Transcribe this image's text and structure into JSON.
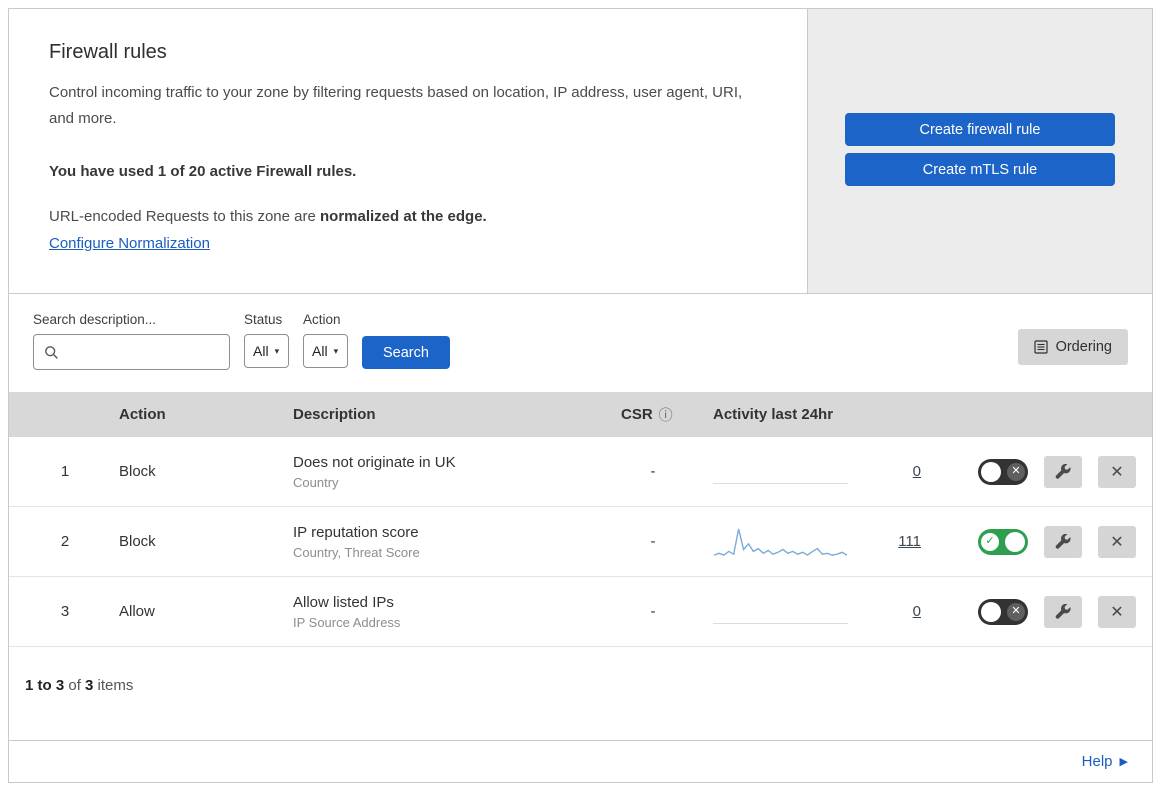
{
  "colors": {
    "primary_blue": "#1d64c8",
    "link_blue": "#1a5dc0",
    "toggle_on_green": "#2e9e4f",
    "toggle_off_dark": "#333333",
    "table_header_gray": "#d8d8d8",
    "side_panel_gray": "#ececec"
  },
  "icons": {
    "caret_down": "▾",
    "info": "ⓘ",
    "check": "✓",
    "cross": "✕",
    "delete_x": "✕",
    "help_arrow": "▶"
  },
  "header": {
    "title": "Firewall rules",
    "description": "Control incoming traffic to your zone by filtering requests based on location, IP address, user agent, URI, and more.",
    "usage": "You have used 1 of 20 active Firewall rules.",
    "normalization_prefix": "URL-encoded Requests to this zone are ",
    "normalization_bold": "normalized at the edge.",
    "configure_link": "Configure Normalization",
    "create_firewall_button": "Create firewall rule",
    "create_mtls_button": "Create mTLS rule"
  },
  "filters": {
    "search_label": "Search description...",
    "search_value": "",
    "status_label": "Status",
    "status_value": "All",
    "action_label": "Action",
    "action_value": "All",
    "search_button": "Search",
    "ordering_button": "Ordering"
  },
  "table": {
    "columns": {
      "action": "Action",
      "description": "Description",
      "csr": "CSR",
      "activity": "Activity last 24hr"
    },
    "rows": [
      {
        "index": "1",
        "action": "Block",
        "description": "Does not originate in UK",
        "criteria": "Country",
        "csr": "-",
        "activity_count": "0",
        "enabled": false
      },
      {
        "index": "2",
        "action": "Block",
        "description": "IP reputation score",
        "criteria": "Country, Threat Score",
        "csr": "-",
        "activity_count": "111",
        "enabled": true,
        "sparkline": [
          2,
          4,
          2,
          6,
          3,
          30,
          8,
          14,
          6,
          9,
          4,
          7,
          3,
          5,
          8,
          4,
          6,
          3,
          5,
          2,
          6,
          9,
          3,
          4,
          2,
          3,
          5,
          2
        ]
      },
      {
        "index": "3",
        "action": "Allow",
        "description": "Allow listed IPs",
        "criteria": "IP Source Address",
        "csr": "-",
        "activity_count": "0",
        "enabled": false
      }
    ]
  },
  "footer": {
    "range": "1 to 3",
    "of_text": " of ",
    "total": "3",
    "items_text": " items",
    "help_label": "Help"
  }
}
